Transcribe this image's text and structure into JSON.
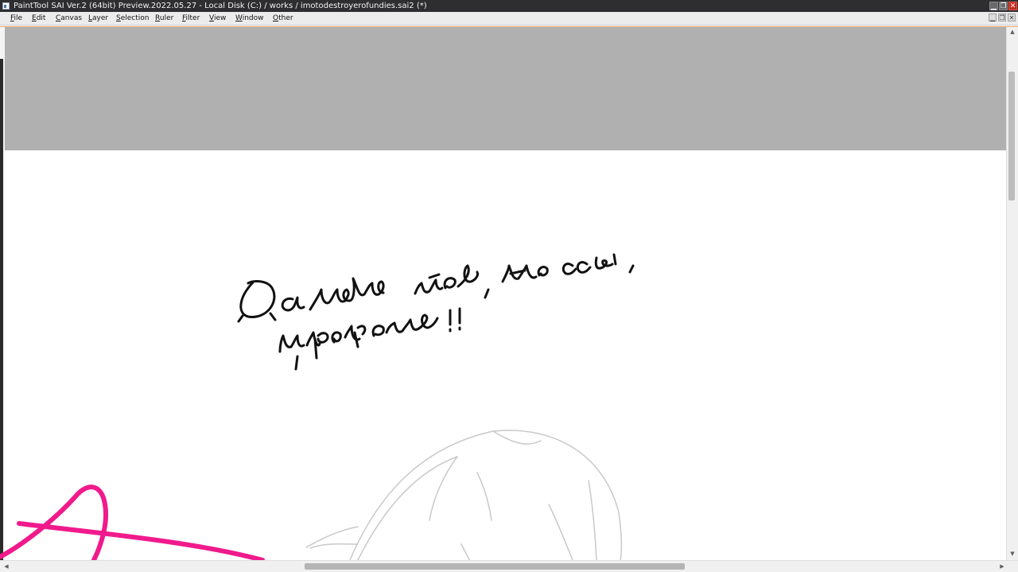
{
  "window": {
    "title": "PaintTool SAI Ver.2 (64bit) Preview.2022.05.27 - Local Disk (C:) / works / imotodestroyerofundies.sai2 (*)",
    "buttons": {
      "minimize": "▁",
      "restore": "❐",
      "close": "✕"
    }
  },
  "menu": {
    "items": [
      "File",
      "Edit",
      "Canvas",
      "Layer",
      "Selection",
      "Ruler",
      "Filter",
      "View",
      "Window",
      "Other"
    ]
  },
  "mdi": {
    "minimize": "▁",
    "restore": "❐",
    "close": "✕"
  },
  "canvas": {
    "handwritten_text": "Да ладно тебе, не ссы, прорвемся !!",
    "background_color": "#b0b0b0",
    "paper_color": "#ffffff",
    "accent_stroke_color": "#f01a8c"
  },
  "scrollbars": {
    "up_arrow": "▲",
    "down_arrow": "▼",
    "left_arrow": "◀",
    "right_arrow": "▶"
  }
}
